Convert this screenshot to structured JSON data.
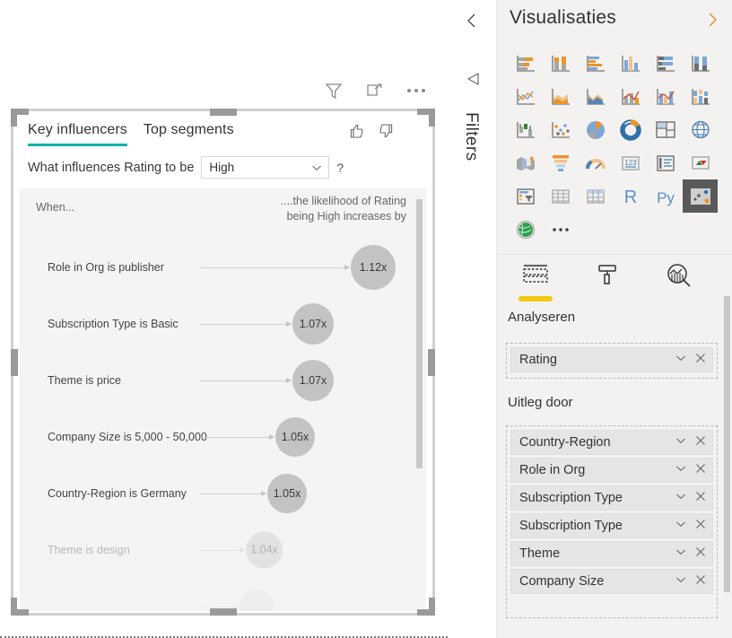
{
  "canvas": {
    "toolbar": [
      {
        "name": "filter-icon",
        "label": "Filter"
      },
      {
        "name": "focus-mode-icon",
        "label": "Focus mode"
      },
      {
        "name": "more-options-icon",
        "label": "More options"
      }
    ]
  },
  "visual": {
    "tabs": [
      {
        "label": "Key influencers",
        "active": true
      },
      {
        "label": "Top segments",
        "active": false
      }
    ],
    "votes": [
      {
        "name": "thumbs-up-icon",
        "label": "Like"
      },
      {
        "name": "thumbs-down-icon",
        "label": "Dislike"
      }
    ],
    "question_label": "What influences Rating to be",
    "selected_value": "High",
    "help_label": "?",
    "column_when": "When...",
    "column_likelihood": "....the likelihood of Rating being High increases by",
    "influencers": [
      {
        "label": "Role in Org is publisher",
        "value": "1.12x",
        "size": 50
      },
      {
        "label": "Subscription Type is Basic",
        "value": "1.07x",
        "size": 46
      },
      {
        "label": "Theme is price",
        "value": "1.07x",
        "size": 46
      },
      {
        "label": "Company Size is 5,000 - 50,000",
        "value": "1.05x",
        "size": 44
      },
      {
        "label": "Country-Region is Germany",
        "value": "1.05x",
        "size": 44
      },
      {
        "label": "Theme is design",
        "value": "1.04x",
        "size": 41
      },
      {
        "label": "",
        "value": "",
        "size": 38
      }
    ]
  },
  "filters_rail": {
    "collapse_label": "Collapse",
    "filter_icon_label": "Filters",
    "title": "Filters"
  },
  "viz_pane": {
    "title": "Visualisaties",
    "expand_label": "Expand",
    "gallery": [
      {
        "name": "stacked-bar-chart-icon"
      },
      {
        "name": "stacked-column-chart-icon"
      },
      {
        "name": "clustered-bar-chart-icon"
      },
      {
        "name": "clustered-column-chart-icon"
      },
      {
        "name": "100-stacked-bar-chart-icon"
      },
      {
        "name": "100-stacked-column-chart-icon"
      },
      {
        "name": "line-chart-icon"
      },
      {
        "name": "area-chart-icon"
      },
      {
        "name": "stacked-area-chart-icon"
      },
      {
        "name": "line-and-stacked-column-chart-icon"
      },
      {
        "name": "line-and-clustered-column-chart-icon"
      },
      {
        "name": "ribbon-chart-icon"
      },
      {
        "name": "waterfall-chart-icon"
      },
      {
        "name": "scatter-chart-icon"
      },
      {
        "name": "pie-chart-icon"
      },
      {
        "name": "donut-chart-icon"
      },
      {
        "name": "treemap-icon"
      },
      {
        "name": "map-icon"
      },
      {
        "name": "filled-map-icon"
      },
      {
        "name": "funnel-icon"
      },
      {
        "name": "gauge-icon"
      },
      {
        "name": "card-icon"
      },
      {
        "name": "multi-row-card-icon"
      },
      {
        "name": "kpi-icon"
      },
      {
        "name": "slicer-icon"
      },
      {
        "name": "table-icon"
      },
      {
        "name": "matrix-icon"
      },
      {
        "name": "r-script-visual-icon"
      },
      {
        "name": "python-visual-icon"
      },
      {
        "name": "key-influencers-icon"
      },
      {
        "name": "arcgis-maps-icon"
      },
      {
        "name": "more-visuals-icon"
      }
    ],
    "property_tabs": [
      {
        "name": "fields-tab",
        "label": "Velden",
        "active": true
      },
      {
        "name": "format-tab",
        "label": "Opmaak",
        "active": false
      },
      {
        "name": "analytics-tab",
        "label": "Analyse",
        "active": false
      }
    ],
    "analyze_label": "Analyseren",
    "analyze_fields": [
      {
        "label": "Rating"
      }
    ],
    "explain_label": "Uitleg door",
    "explain_fields": [
      {
        "label": "Country-Region"
      },
      {
        "label": "Role in Org"
      },
      {
        "label": "Subscription Type"
      },
      {
        "label": "Subscription Type"
      },
      {
        "label": "Theme"
      },
      {
        "label": "Company Size"
      }
    ],
    "chip_controls": {
      "chevron": "⌄",
      "remove": "✕"
    }
  },
  "colors": {
    "accent_teal": "#00b4a8",
    "accent_yellow": "#f2c811",
    "pane_bg": "#f3f2f1",
    "bubble_gray": "#c3c3c3",
    "expand_orange": "#d98d2b"
  }
}
